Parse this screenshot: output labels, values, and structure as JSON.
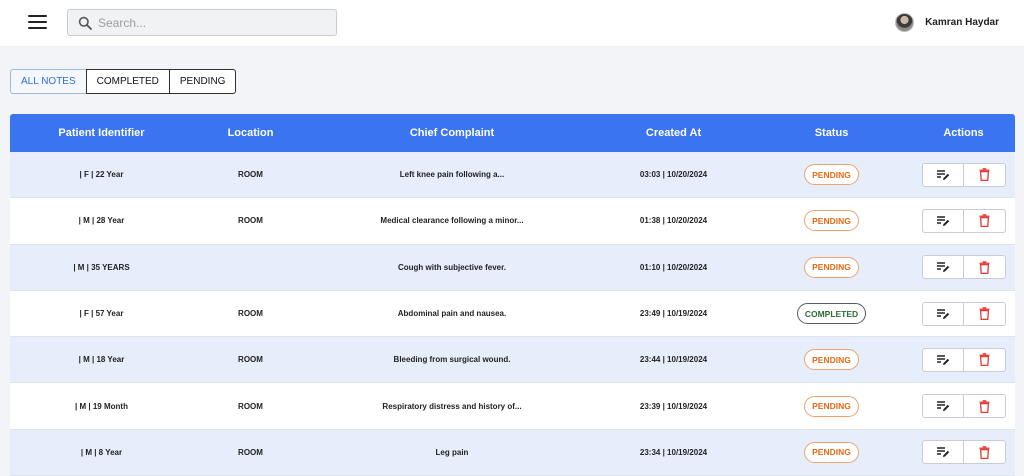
{
  "header": {
    "search_placeholder": "Search...",
    "user_name": "Kamran Haydar"
  },
  "filters": [
    "ALL NOTES",
    "COMPLETED",
    "PENDING"
  ],
  "active_filter": "ALL NOTES",
  "table": {
    "columns": [
      "Patient Identifier",
      "Location",
      "Chief Complaint",
      "Created At",
      "Status",
      "Actions"
    ],
    "rows": [
      {
        "patient": "| F | 22 Year",
        "location": "ROOM",
        "complaint": "Left knee pain following a...",
        "created": "03:03 | 10/20/2024",
        "status": "PENDING"
      },
      {
        "patient": "| M | 28 Year",
        "location": "ROOM",
        "complaint": "Medical clearance following a minor...",
        "created": "01:38 | 10/20/2024",
        "status": "PENDING"
      },
      {
        "patient": "| M | 35 YEARS",
        "location": "",
        "complaint": "Cough with subjective fever.",
        "created": "01:10 | 10/20/2024",
        "status": "PENDING"
      },
      {
        "patient": "| F | 57 Year",
        "location": "ROOM",
        "complaint": "Abdominal pain and nausea.",
        "created": "23:49 | 10/19/2024",
        "status": "COMPLETED"
      },
      {
        "patient": "| M | 18 Year",
        "location": "ROOM",
        "complaint": "Bleeding from surgical wound.",
        "created": "23:44 | 10/19/2024",
        "status": "PENDING"
      },
      {
        "patient": "| M | 19 Month",
        "location": "ROOM",
        "complaint": "Respiratory distress and history of...",
        "created": "23:39 | 10/19/2024",
        "status": "PENDING"
      },
      {
        "patient": "| M | 8 Year",
        "location": "ROOM",
        "complaint": "Leg pain",
        "created": "23:34 | 10/19/2024",
        "status": "PENDING"
      }
    ]
  },
  "icons": {
    "menu": "hamburger-menu-icon",
    "search": "search-icon",
    "edit": "edit-note-icon",
    "delete": "trash-icon"
  },
  "colors": {
    "header_blue": "#3a74f1",
    "pending": "#e86a16",
    "completed": "#2f6b35",
    "delete_red": "#e53935"
  }
}
